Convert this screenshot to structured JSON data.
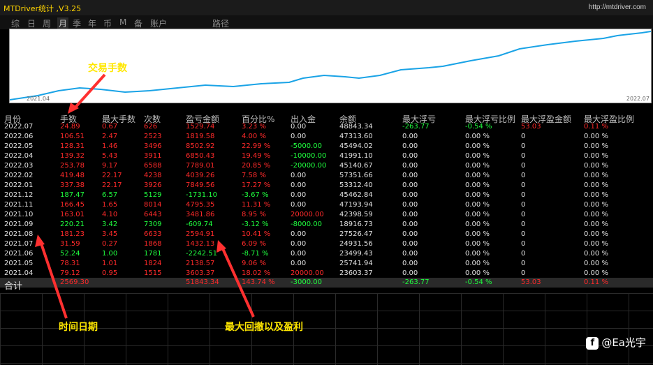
{
  "window": {
    "title": "MTDriver统计 ,V3.25",
    "url": "http://mtdriver.com"
  },
  "tabs": [
    "综",
    "日",
    "周",
    "月",
    "季",
    "年",
    "币",
    "M",
    "备",
    "账户",
    "路径"
  ],
  "active_tab": "月",
  "chart": {
    "start_label": "2021.04",
    "end_label": "2022.07"
  },
  "headers": [
    "月份",
    "手数",
    "最大手数",
    "次数",
    "盈亏金额",
    "百分比%",
    "出入金",
    "余额",
    "最大浮亏",
    "最大浮亏比例",
    "最大浮盈金额",
    "最大浮盈比例"
  ],
  "rows": [
    {
      "cells": [
        "2022.07",
        "24.89",
        "0.67",
        "626",
        "1529.74",
        "3.23 %",
        "0.00",
        "48843.34",
        "-263.77",
        "-0.54 %",
        "53.03",
        "0.11 %"
      ],
      "pnl": "red",
      "io": "white",
      "mfl": "green",
      "mflp": "green",
      "mfp": "red",
      "mfpp": "red"
    },
    {
      "cells": [
        "2022.06",
        "106.51",
        "2.47",
        "2523",
        "1819.58",
        "4.00 %",
        "0.00",
        "47313.60",
        "0.00",
        "0.00 %",
        "0",
        "0.00 %"
      ],
      "pnl": "red",
      "io": "white"
    },
    {
      "cells": [
        "2022.05",
        "128.31",
        "1.46",
        "3496",
        "8502.92",
        "22.99 %",
        "-5000.00",
        "45494.02",
        "0.00",
        "0.00 %",
        "0",
        "0.00 %"
      ],
      "pnl": "red",
      "io": "green"
    },
    {
      "cells": [
        "2022.04",
        "139.32",
        "5.43",
        "3911",
        "6850.43",
        "19.49 %",
        "-10000.00",
        "41991.10",
        "0.00",
        "0.00 %",
        "0",
        "0.00 %"
      ],
      "pnl": "red",
      "io": "green"
    },
    {
      "cells": [
        "2022.03",
        "253.78",
        "9.17",
        "6588",
        "7789.01",
        "20.85 %",
        "-20000.00",
        "45140.67",
        "0.00",
        "0.00 %",
        "0",
        "0.00 %"
      ],
      "pnl": "red",
      "io": "green"
    },
    {
      "cells": [
        "2022.02",
        "419.48",
        "22.17",
        "4238",
        "4039.26",
        "7.58 %",
        "0.00",
        "57351.66",
        "0.00",
        "0.00 %",
        "0",
        "0.00 %"
      ],
      "pnl": "red",
      "io": "white"
    },
    {
      "cells": [
        "2022.01",
        "337.38",
        "22.17",
        "3926",
        "7849.56",
        "17.27 %",
        "0.00",
        "53312.40",
        "0.00",
        "0.00 %",
        "0",
        "0.00 %"
      ],
      "pnl": "red",
      "io": "white"
    },
    {
      "cells": [
        "2021.12",
        "187.47",
        "6.57",
        "5129",
        "-1731.10",
        "-3.67 %",
        "0.00",
        "45462.84",
        "0.00",
        "0.00 %",
        "0",
        "0.00 %"
      ],
      "pnl": "green",
      "io": "white"
    },
    {
      "cells": [
        "2021.11",
        "166.45",
        "1.65",
        "8014",
        "4795.35",
        "11.31 %",
        "0.00",
        "47193.94",
        "0.00",
        "0.00 %",
        "0",
        "0.00 %"
      ],
      "pnl": "red",
      "io": "white"
    },
    {
      "cells": [
        "2021.10",
        "163.01",
        "4.10",
        "6443",
        "3481.86",
        "8.95 %",
        "20000.00",
        "42398.59",
        "0.00",
        "0.00 %",
        "0",
        "0.00 %"
      ],
      "pnl": "red",
      "io": "red"
    },
    {
      "cells": [
        "2021.09",
        "220.21",
        "3.42",
        "7309",
        "-609.74",
        "-3.12 %",
        "-8000.00",
        "18916.73",
        "0.00",
        "0.00 %",
        "0",
        "0.00 %"
      ],
      "pnl": "green",
      "io": "green"
    },
    {
      "cells": [
        "2021.08",
        "181.23",
        "3.45",
        "6633",
        "2594.91",
        "10.41 %",
        "0.00",
        "27526.47",
        "0.00",
        "0.00 %",
        "0",
        "0.00 %"
      ],
      "pnl": "red",
      "io": "white"
    },
    {
      "cells": [
        "2021.07",
        "31.59",
        "0.27",
        "1868",
        "1432.13",
        "6.09 %",
        "0.00",
        "24931.56",
        "0.00",
        "0.00 %",
        "0",
        "0.00 %"
      ],
      "pnl": "red",
      "io": "white"
    },
    {
      "cells": [
        "2021.06",
        "52.24",
        "1.00",
        "1781",
        "-2242.51",
        "-8.71 %",
        "0.00",
        "23499.43",
        "0.00",
        "0.00 %",
        "0",
        "0.00 %"
      ],
      "pnl": "green",
      "io": "white"
    },
    {
      "cells": [
        "2021.05",
        "78.31",
        "1.01",
        "1824",
        "2138.57",
        "9.06 %",
        "0.00",
        "25741.94",
        "0.00",
        "0.00 %",
        "0",
        "0.00 %"
      ],
      "pnl": "red",
      "io": "white"
    },
    {
      "cells": [
        "2021.04",
        "79.12",
        "0.95",
        "1515",
        "3603.37",
        "18.02 %",
        "20000.00",
        "23603.37",
        "0.00",
        "0.00 %",
        "0",
        "0.00 %"
      ],
      "pnl": "red",
      "io": "red"
    }
  ],
  "total": {
    "label": "合计",
    "lots": "2569.30",
    "pnl": "51843.34",
    "pct": "143.74 %",
    "io": "-3000.00",
    "max_float_loss": "-263.77",
    "max_float_loss_pct": "-0.54 %",
    "max_float_profit": "53.03",
    "max_float_profit_pct": "0.11 %"
  },
  "annotations": {
    "fee": "交易手数",
    "date": "时间日期",
    "pnl": "最大回撤以及盈利"
  },
  "watermark": "@Ea光宇"
}
